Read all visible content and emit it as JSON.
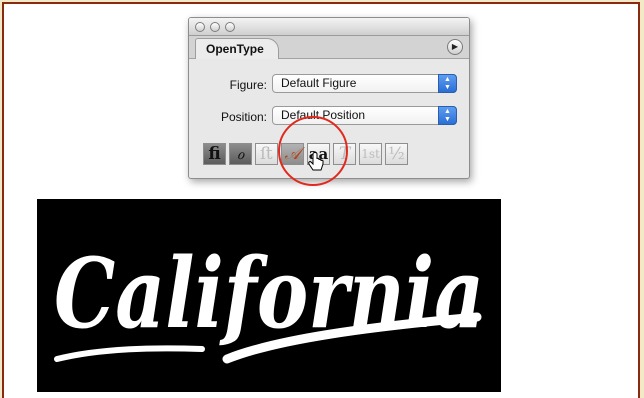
{
  "panel": {
    "tab_label": "OpenType",
    "menu_icon": "triangle-right",
    "figure": {
      "label": "Figure:",
      "value": "Default Figure"
    },
    "position": {
      "label": "Position:",
      "value": "Default Position"
    },
    "buttons": [
      {
        "glyph": "fi",
        "name": "standard-ligatures-icon",
        "state": "on"
      },
      {
        "glyph": "ℴ",
        "name": "contextual-alternates-icon",
        "state": "on"
      },
      {
        "glyph": "ﬅ",
        "name": "discretionary-ligatures-icon",
        "state": "off"
      },
      {
        "glyph": "𝒜",
        "name": "swash-icon",
        "state": "hover"
      },
      {
        "glyph": "aa",
        "name": "stylistic-alternates-icon",
        "state": "on"
      },
      {
        "glyph": "T",
        "name": "titling-alternates-icon",
        "state": "off"
      },
      {
        "glyph": "1st",
        "name": "ordinals-icon",
        "state": "off"
      },
      {
        "glyph": "½",
        "name": "fractions-icon",
        "state": "off"
      }
    ]
  },
  "sample": {
    "text": "California",
    "color": "#ffffff",
    "background": "#000000"
  },
  "colors": {
    "frame_border": "#8a2a10",
    "highlight_circle": "#e02a1f"
  }
}
